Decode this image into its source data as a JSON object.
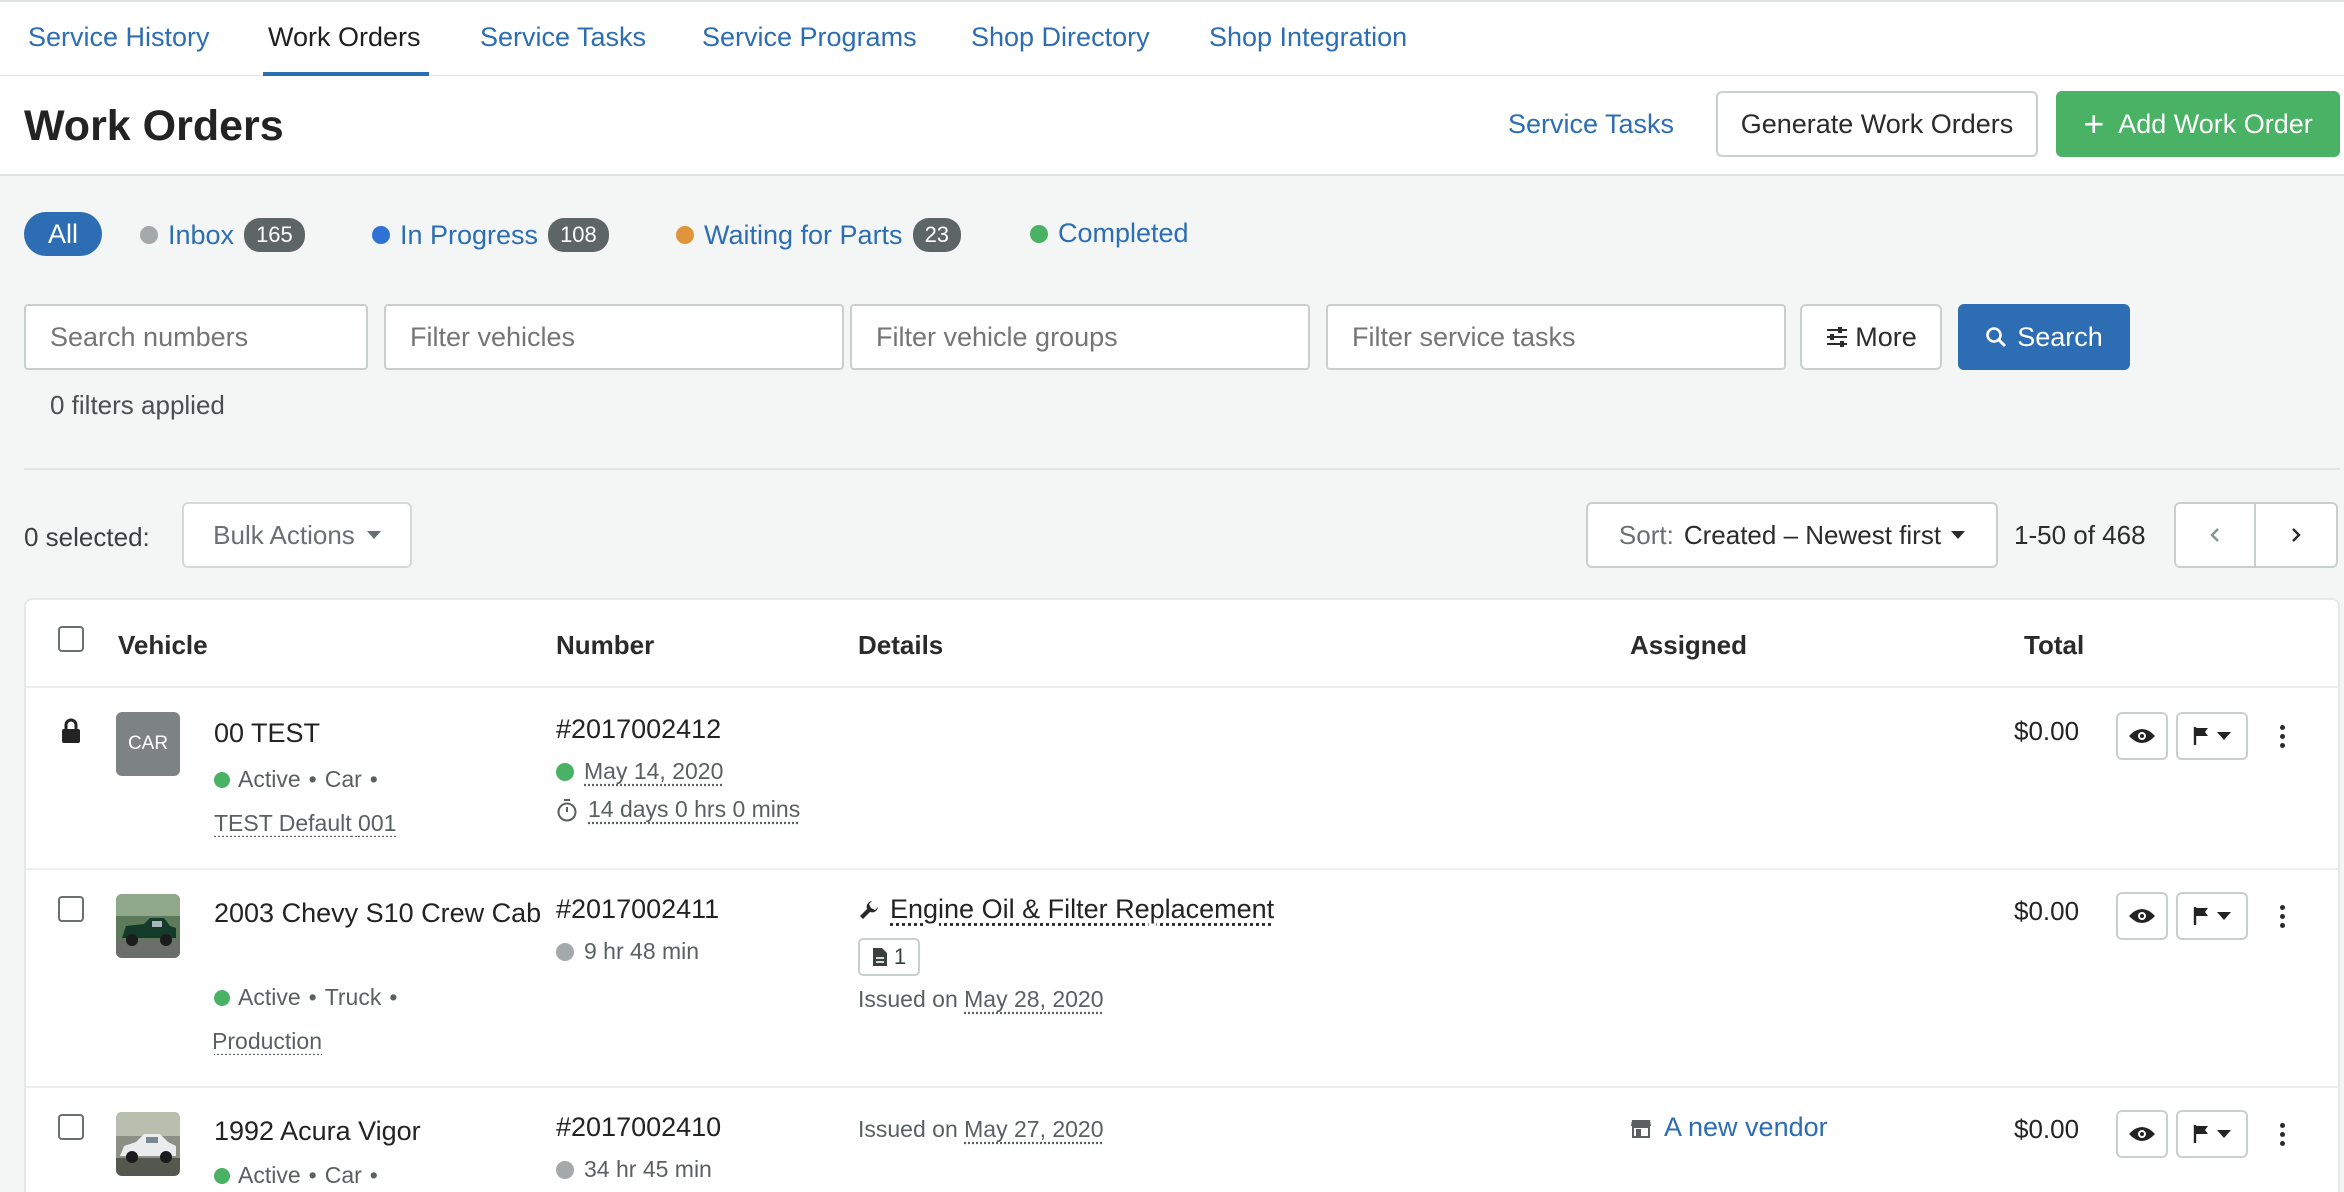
{
  "nav": {
    "tabs": [
      {
        "label": "Service History"
      },
      {
        "label": "Work Orders"
      },
      {
        "label": "Service Tasks"
      },
      {
        "label": "Service Programs"
      },
      {
        "label": "Shop Directory"
      },
      {
        "label": "Shop Integration"
      }
    ],
    "active": "Work Orders"
  },
  "header": {
    "title": "Work Orders",
    "service_tasks_link": "Service Tasks",
    "generate_label": "Generate Work Orders",
    "add_label": "Add Work Order"
  },
  "status_filters": {
    "all_label": "All",
    "items": [
      {
        "label": "Inbox",
        "count": "165",
        "color": "#a4a9aa"
      },
      {
        "label": "In Progress",
        "count": "108",
        "color": "#2f72d6"
      },
      {
        "label": "Waiting for Parts",
        "count": "23",
        "color": "#e0953a"
      },
      {
        "label": "Completed",
        "count": "",
        "color": "#49b264"
      }
    ]
  },
  "filters": {
    "search_numbers_placeholder": "Search numbers",
    "filter_vehicles_placeholder": "Filter vehicles",
    "filter_vehicle_groups_placeholder": "Filter vehicle groups",
    "filter_service_tasks_placeholder": "Filter service tasks",
    "more_label": "More",
    "search_label": "Search",
    "applied_text": "0 filters applied"
  },
  "toolbar": {
    "selected_text": "0 selected:",
    "bulk_actions_label": "Bulk Actions",
    "sort_prefix": "Sort:",
    "sort_value": "Created – Newest first",
    "range_text": "1-50 of 468"
  },
  "table": {
    "columns": [
      "Vehicle",
      "Number",
      "Details",
      "Assigned",
      "Total"
    ],
    "rows": [
      {
        "vehicle_name": "00 TEST",
        "thumb_label": "CAR",
        "status": "Active",
        "type": "Car",
        "group": "001 TEST Default",
        "number": "#2017002412",
        "number_meta": "May 14, 2020",
        "duration": "14 days 0 hrs 0 mins",
        "detail_task": "",
        "doc_count": "",
        "issued_prefix": "",
        "issued_date": "",
        "assigned": "",
        "total": "$0.00",
        "status_color": "#49b264"
      },
      {
        "vehicle_name": "2003 Chevy S10 Crew Cab",
        "status": "Active",
        "type": "Truck",
        "group": "Production",
        "number": "#2017002411",
        "number_meta": "9 hr 48 min",
        "detail_task": "Engine Oil & Filter Replacement",
        "doc_count": "1",
        "issued_prefix": "Issued on",
        "issued_date": "May 28, 2020",
        "assigned": "",
        "total": "$0.00"
      },
      {
        "vehicle_name": "1992 Acura Vigor",
        "status": "Active",
        "type": "Car",
        "group": "",
        "number": "#2017002410",
        "number_meta": "34 hr 45 min",
        "issued_prefix": "Issued on",
        "issued_date": "May 27, 2020",
        "assigned": "A new vendor",
        "total": "$0.00"
      }
    ]
  },
  "colors": {
    "accent": "#2c6db3",
    "green": "#49b264",
    "active_dot": "#49b264",
    "neutral_dot": "#a4a9aa"
  },
  "icons": [
    "plus-icon",
    "sliders-icon",
    "search-icon",
    "chevron-left-icon",
    "chevron-right-icon",
    "lock-icon",
    "timer-icon",
    "wrench-icon",
    "document-icon",
    "store-icon",
    "eye-icon",
    "flag-icon",
    "kebab-icon"
  ]
}
